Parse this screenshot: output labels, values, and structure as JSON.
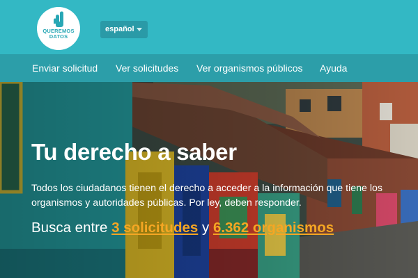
{
  "logo": {
    "line1": "QUEREMOS",
    "line2": "DATOS",
    "icon": "raised-hand-icon"
  },
  "language": {
    "selected": "español"
  },
  "nav": {
    "items": [
      {
        "label": "Enviar solicitud"
      },
      {
        "label": "Ver solicitudes"
      },
      {
        "label": "Ver organismos públicos"
      },
      {
        "label": "Ayuda"
      }
    ]
  },
  "hero": {
    "title": "Tu derecho a saber",
    "text": "Todos los ciudadanos tienen el derecho a acceder a la información que tiene los organismos y autoridades públicas. Por ley, deben responder.",
    "search_prefix": "Busca entre ",
    "requests_link": "3 solicitudes",
    "search_joiner": " y ",
    "organisms_link": "6.362 organismos"
  },
  "colors": {
    "top_bar": "#33b8c4",
    "nav_bar": "#2c9ea9",
    "link_accent": "#f5a623"
  }
}
